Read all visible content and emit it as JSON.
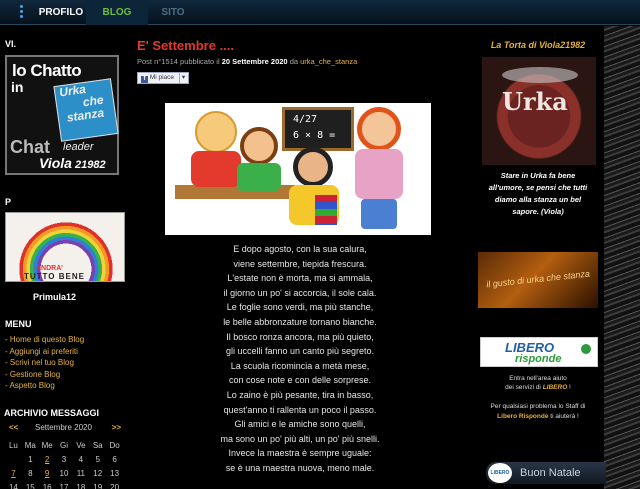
{
  "topbar": {
    "tabs": [
      "PROFILO",
      "BLOG",
      "SITO"
    ]
  },
  "left": {
    "vl_title": "VI.",
    "chatto_image": {
      "line1": "lo Chatto",
      "line2": "in",
      "urka": [
        "Urka",
        "che",
        "stanza"
      ],
      "chat": "Chat",
      "leader": "leader",
      "name": "Viola",
      "number": "21982"
    },
    "p_title": "P",
    "primula_image": {
      "andra": "ANDRA'",
      "tutto": "TUTTO BENE"
    },
    "primula_caption": "Primula12",
    "menu_title": "MENU",
    "menu_items": [
      "- Home di questo Blog",
      "- Aggiungi ai preferiti",
      "- Scrivi nel tuo Blog",
      "- Gestione Blog",
      "- Aspetto Blog"
    ],
    "archive_title": "ARCHIVIO MESSAGGI",
    "calendar": {
      "prev": "<<",
      "month": "Settembre 2020",
      "next": ">>",
      "weekdays": [
        "Lu",
        "Ma",
        "Me",
        "Gi",
        "Ve",
        "Sa",
        "Do"
      ],
      "rows": [
        [
          "",
          "1",
          "2",
          "3",
          "4",
          "5",
          "6"
        ],
        [
          "7",
          "8",
          "9",
          "10",
          "11",
          "12",
          "13"
        ],
        [
          "14",
          "15",
          "16",
          "17",
          "18",
          "19",
          "20"
        ]
      ],
      "linked_days": [
        "2",
        "7",
        "9"
      ]
    }
  },
  "post": {
    "title": "E' Settembre ....",
    "meta_prefix": "Post n°1514 pubblicato il ",
    "date": "20 Settembre 2020",
    "meta_mid": " da ",
    "author": "urka_che_stanza",
    "like_label": "Mi piace",
    "board_text": [
      "4/27",
      "6 × 8 ="
    ],
    "poem": [
      "E dopo agosto, con la sua calura,",
      "viene settembre, tiepida frescura.",
      "L'estate non è morta, ma si ammala,",
      "il giorno un po' si accorcia, il sole cala.",
      "Le foglie sono verdi, ma più stanche,",
      "le belle abbronzature tornano bianche.",
      "Il bosco ronza ancora, ma più quieto,",
      "gli uccelli fanno un canto più segreto.",
      "La scuola ricomincia a metà mese,",
      "con cose note e con delle sorprese.",
      "Lo zaino è più pesante, tira in basso,",
      "quest'anno ti rallenta un poco il passo.",
      "Gli amici e le amiche sono quelli,",
      "ma sono un po' più alti, un po' più snelli.",
      "Invece la maestra è sempre uguale:",
      "se è una maestra nuova, meno male."
    ]
  },
  "right": {
    "torta_title": "La Torta di Viola21982",
    "torta_text": "Urka",
    "torta_caption": [
      "Stare in Urka fa bene",
      "all'umore, se pensi  che tutti",
      "diamo alla stanza un bel",
      "sapore.  (Viola)"
    ],
    "gusto_text": "il gusto di urka che stanza",
    "libero": {
      "line1": "LIBERO",
      "line2": "risponde"
    },
    "help1_a": "Entra nell'area aiuto",
    "help1_b": "dei servizi di ",
    "help1_lib": "LIBERO",
    "help1_c": " !",
    "help2_a": "Per qualsiasi problema  lo Staff di",
    "help2_lib": "Libero Risponde",
    "help2_b": " ti aiuterà !",
    "natale_badge": "LIBERO",
    "natale": "Buon Natale"
  },
  "colors": {
    "accent_red": "#e03a2a",
    "link_gold": "#e6b23a",
    "blog_green": "#6fbf3a",
    "topbar": "#10283c"
  }
}
